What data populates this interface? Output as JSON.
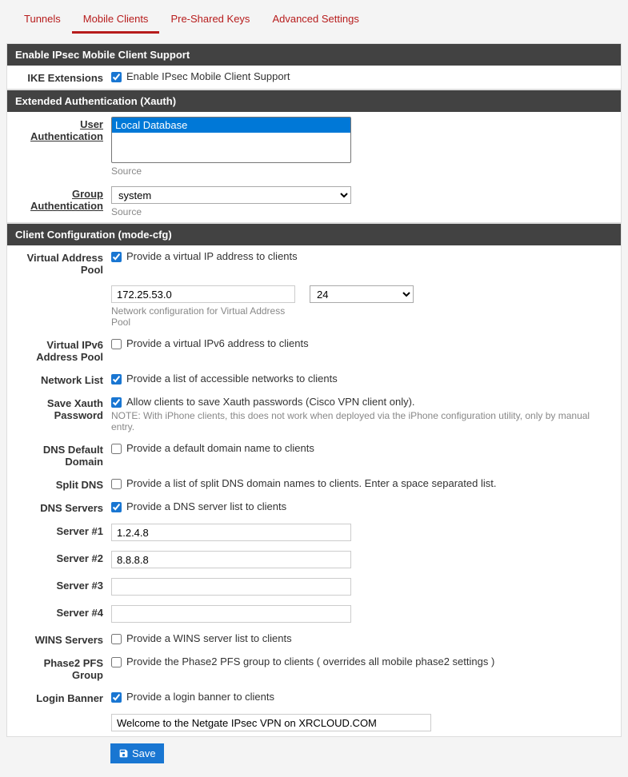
{
  "tabs": {
    "tunnels": "Tunnels",
    "mobile_clients": "Mobile Clients",
    "preshared_keys": "Pre-Shared Keys",
    "advanced_settings": "Advanced Settings"
  },
  "panel1": {
    "title": "Enable IPsec Mobile Client Support",
    "ike_ext_label": "IKE Extensions",
    "ike_ext_text": "Enable IPsec Mobile Client Support"
  },
  "panel2": {
    "title": "Extended Authentication (Xauth)",
    "user_auth_label": "User Authentication",
    "user_auth_option": "Local Database",
    "user_auth_help": "Source",
    "group_auth_label": "Group Authentication",
    "group_auth_option": "system",
    "group_auth_help": "Source"
  },
  "panel3": {
    "title": "Client Configuration (mode-cfg)",
    "vap_label": "Virtual Address Pool",
    "vap_text": "Provide a virtual IP address to clients",
    "vap_net": "172.25.53.0",
    "vap_mask": "24",
    "vap_help": "Network configuration for Virtual Address Pool",
    "vip6_label": "Virtual IPv6 Address Pool",
    "vip6_text": "Provide a virtual IPv6 address to clients",
    "netlist_label": "Network List",
    "netlist_text": "Provide a list of accessible networks to clients",
    "xauth_label": "Save Xauth Password",
    "xauth_text": "Allow clients to save Xauth passwords (Cisco VPN client only).",
    "xauth_help": "NOTE: With iPhone clients, this does not work when deployed via the iPhone configuration utility, only by manual entry.",
    "dnsdef_label": "DNS Default Domain",
    "dnsdef_text": "Provide a default domain name to clients",
    "splitdns_label": "Split DNS",
    "splitdns_text": "Provide a list of split DNS domain names to clients. Enter a space separated list.",
    "dnssrv_label": "DNS Servers",
    "dnssrv_text": "Provide a DNS server list to clients",
    "s1_label": "Server #1",
    "s1_val": "1.2.4.8",
    "s2_label": "Server #2",
    "s2_val": "8.8.8.8",
    "s3_label": "Server #3",
    "s3_val": "",
    "s4_label": "Server #4",
    "s4_val": "",
    "wins_label": "WINS Servers",
    "wins_text": "Provide a WINS server list to clients",
    "pfs_label": "Phase2 PFS Group",
    "pfs_text": "Provide the Phase2 PFS group to clients ( overrides all mobile phase2 settings )",
    "banner_label": "Login Banner",
    "banner_text": "Provide a login banner to clients",
    "banner_val": "Welcome to the Netgate IPsec VPN on XRCLOUD.COM"
  },
  "save_btn": "Save"
}
